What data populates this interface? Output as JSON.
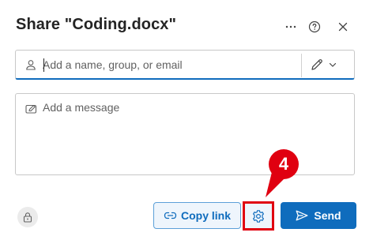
{
  "dialog": {
    "title": "Share \"Coding.docx\"",
    "header_icons": [
      "more-icon",
      "help-icon",
      "close-icon"
    ]
  },
  "recipients": {
    "placeholder": "Add a name, group, or email",
    "value": "",
    "icon": "person-icon",
    "permission_icons": [
      "pencil-icon",
      "chevron-down-icon"
    ]
  },
  "message": {
    "placeholder": "Add a message",
    "icon": "message-icon"
  },
  "footer": {
    "lock_icon": "lock-icon",
    "copy_link_label": "Copy link",
    "copy_link_icon": "link-icon",
    "settings_icon": "gear-icon",
    "send_label": "Send",
    "send_icon": "send-icon"
  },
  "annotation": {
    "step_number": "4",
    "color": "#e00010"
  },
  "colors": {
    "accent": "#0f6cbd",
    "annotation_red": "#e00010"
  }
}
